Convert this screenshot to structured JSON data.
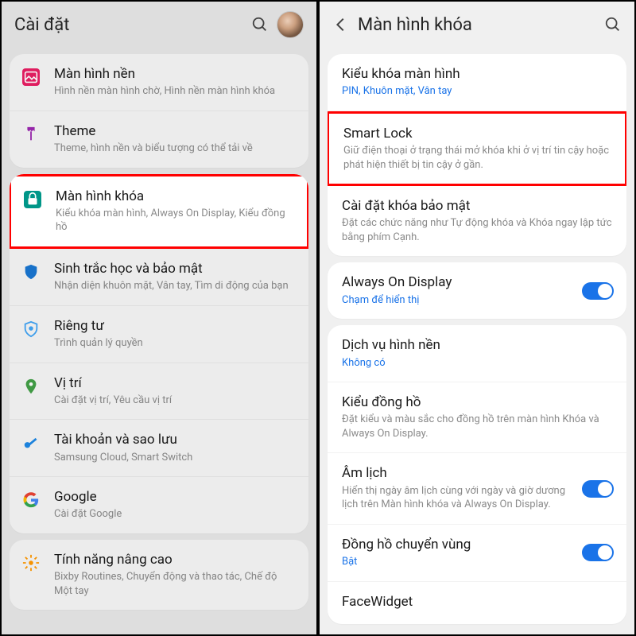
{
  "left": {
    "title": "Cài đặt",
    "items": [
      {
        "icon": "wallpaper",
        "label": "Màn hình nền",
        "sub": "Hình nền màn hình chờ, Hình nền màn hình khóa"
      },
      {
        "icon": "theme",
        "label": "Theme",
        "sub": "Theme, hình nền và biểu tượng có thể tải về"
      },
      {
        "icon": "lock",
        "label": "Màn hình khóa",
        "sub": "Kiểu khóa màn hình, Always On Display, Kiểu đồng hồ",
        "highlight": true
      },
      {
        "icon": "biometric",
        "label": "Sinh trắc học và bảo mật",
        "sub": "Nhận diện khuôn mặt, Vân tay, Tìm di động của bạn"
      },
      {
        "icon": "privacy",
        "label": "Riêng tư",
        "sub": "Trình quản lý quyền"
      },
      {
        "icon": "location",
        "label": "Vị trí",
        "sub": "Cài đặt vị trí, Yêu cầu vị trí"
      },
      {
        "icon": "account",
        "label": "Tài khoản và sao lưu",
        "sub": "Samsung Cloud, Smart Switch"
      },
      {
        "icon": "google",
        "label": "Google",
        "sub": "Cài đặt Google"
      },
      {
        "icon": "advanced",
        "label": "Tính năng nâng cao",
        "sub": "Bixby Routines, Chuyển động và thao tác, Chế độ Một tay"
      }
    ]
  },
  "right": {
    "title": "Màn hình khóa",
    "items": [
      {
        "label": "Kiểu khóa màn hình",
        "sub": "PIN, Khuôn mặt, Vân tay",
        "blue": true
      },
      {
        "label": "Smart Lock",
        "sub": "Giữ điện thoại ở trạng thái mở khóa khi ở vị trí tin cậy hoặc phát hiện thiết bị tin cậy ở gần.",
        "highlight": true
      },
      {
        "label": "Cài đặt khóa bảo mật",
        "sub": "Đặt các chức năng như Tự động khóa và Khóa ngay lập tức bằng phím Cạnh."
      },
      {
        "label": "Always On Display",
        "sub": "Chạm để hiển thị",
        "blue": true,
        "toggle": true
      },
      {
        "label": "Dịch vụ hình nền",
        "sub": "Không có",
        "blue": true
      },
      {
        "label": "Kiểu đồng hồ",
        "sub": "Đặt kiểu và màu sắc cho đồng hồ trên màn hình Khóa và Always On Display."
      },
      {
        "label": "Âm lịch",
        "sub": "Hiển thị ngày âm lịch cùng với ngày và giờ dương lịch trên Màn hình khóa và Always On Display.",
        "toggle": true
      },
      {
        "label": "Đồng hồ chuyển vùng",
        "sub": "Bật",
        "blue": true,
        "toggle": true
      },
      {
        "label": "FaceWidget",
        "sub": ""
      }
    ]
  }
}
